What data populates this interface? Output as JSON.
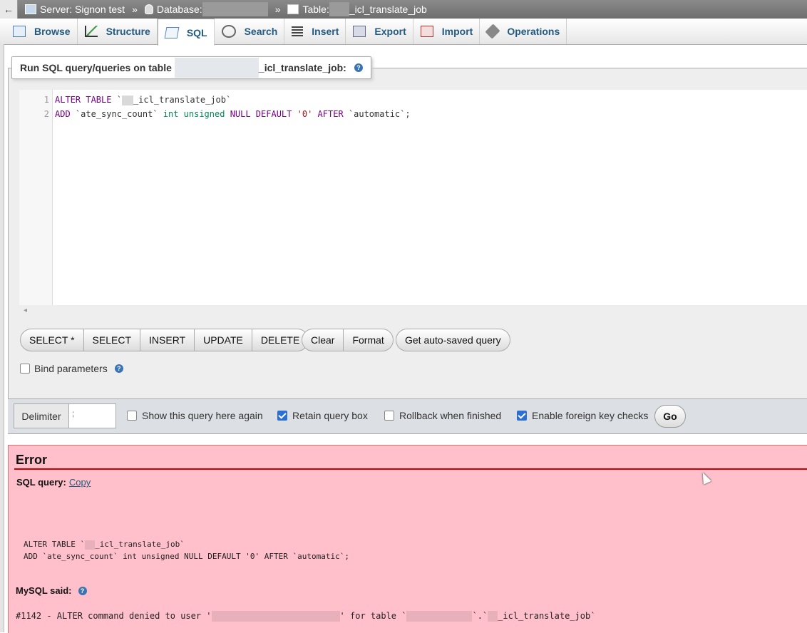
{
  "breadcrumb": {
    "collapse_symbol": "←",
    "server": "Server: Signon test",
    "database_label": "Database:",
    "table_label": "Table:",
    "table_suffix": "_icl_translate_job",
    "separator": "»"
  },
  "tabs": [
    {
      "label": "Browse",
      "icon": "browse-icon"
    },
    {
      "label": "Structure",
      "icon": "structure-icon"
    },
    {
      "label": "SQL",
      "icon": "sql-icon",
      "active": true
    },
    {
      "label": "Search",
      "icon": "search-icon"
    },
    {
      "label": "Insert",
      "icon": "insert-icon"
    },
    {
      "label": "Export",
      "icon": "export-icon"
    },
    {
      "label": "Import",
      "icon": "import-icon"
    },
    {
      "label": "Operations",
      "icon": "operations-icon"
    }
  ],
  "query_panel": {
    "legend_prefix": "Run SQL query/queries on table",
    "legend_suffix": "_icl_translate_job:",
    "line_numbers": [
      "1",
      "2"
    ],
    "code_line1_kw": "ALTER TABLE",
    "code_line1_tick": "`",
    "code_line1_tbl": "_icl_translate_job`",
    "code_line2_add": "ADD",
    "code_line2_col": "`ate_sync_count`",
    "code_line2_type": "int unsigned",
    "code_line2_null": "NULL DEFAULT",
    "code_line2_val": "'0'",
    "code_line2_after": "AFTER",
    "code_line2_ref": "`automatic`",
    "code_line2_end": ";",
    "scroll_arrow": "◂"
  },
  "buttons": {
    "template": [
      "SELECT *",
      "SELECT",
      "INSERT",
      "UPDATE",
      "DELETE"
    ],
    "clear": "Clear",
    "format": "Format",
    "autosaved": "Get auto-saved query"
  },
  "bind_parameters": {
    "label": "Bind parameters",
    "checked": false
  },
  "options": {
    "delimiter_label": "Delimiter",
    "delimiter_value": ";",
    "show_query": {
      "label": "Show this query here again",
      "checked": false
    },
    "retain_box": {
      "label": "Retain query box",
      "checked": true
    },
    "rollback": {
      "label": "Rollback when finished",
      "checked": false
    },
    "foreign_keys": {
      "label": "Enable foreign key checks",
      "checked": true
    },
    "go": "Go"
  },
  "error": {
    "title": "Error",
    "sql_query_label": "SQL query:",
    "copy_link": "Copy",
    "query_line1_prefix": "ALTER TABLE `",
    "query_line1_suffix": "_icl_translate_job`",
    "query_line2": "ADD `ate_sync_count` int unsigned NULL DEFAULT '0' AFTER `automatic`;",
    "mysql_said": "MySQL said:",
    "msg_prefix": "#1142 - ALTER command denied to user '",
    "msg_mid": "' for table `",
    "msg_mid2": "`.`",
    "msg_suffix": "_icl_translate_job`"
  },
  "colors": {
    "error_bg": "#ffc0cb",
    "error_rule": "#cc0000",
    "tab_text": "#235a81",
    "checkbox_on": "#2a6fd3"
  }
}
